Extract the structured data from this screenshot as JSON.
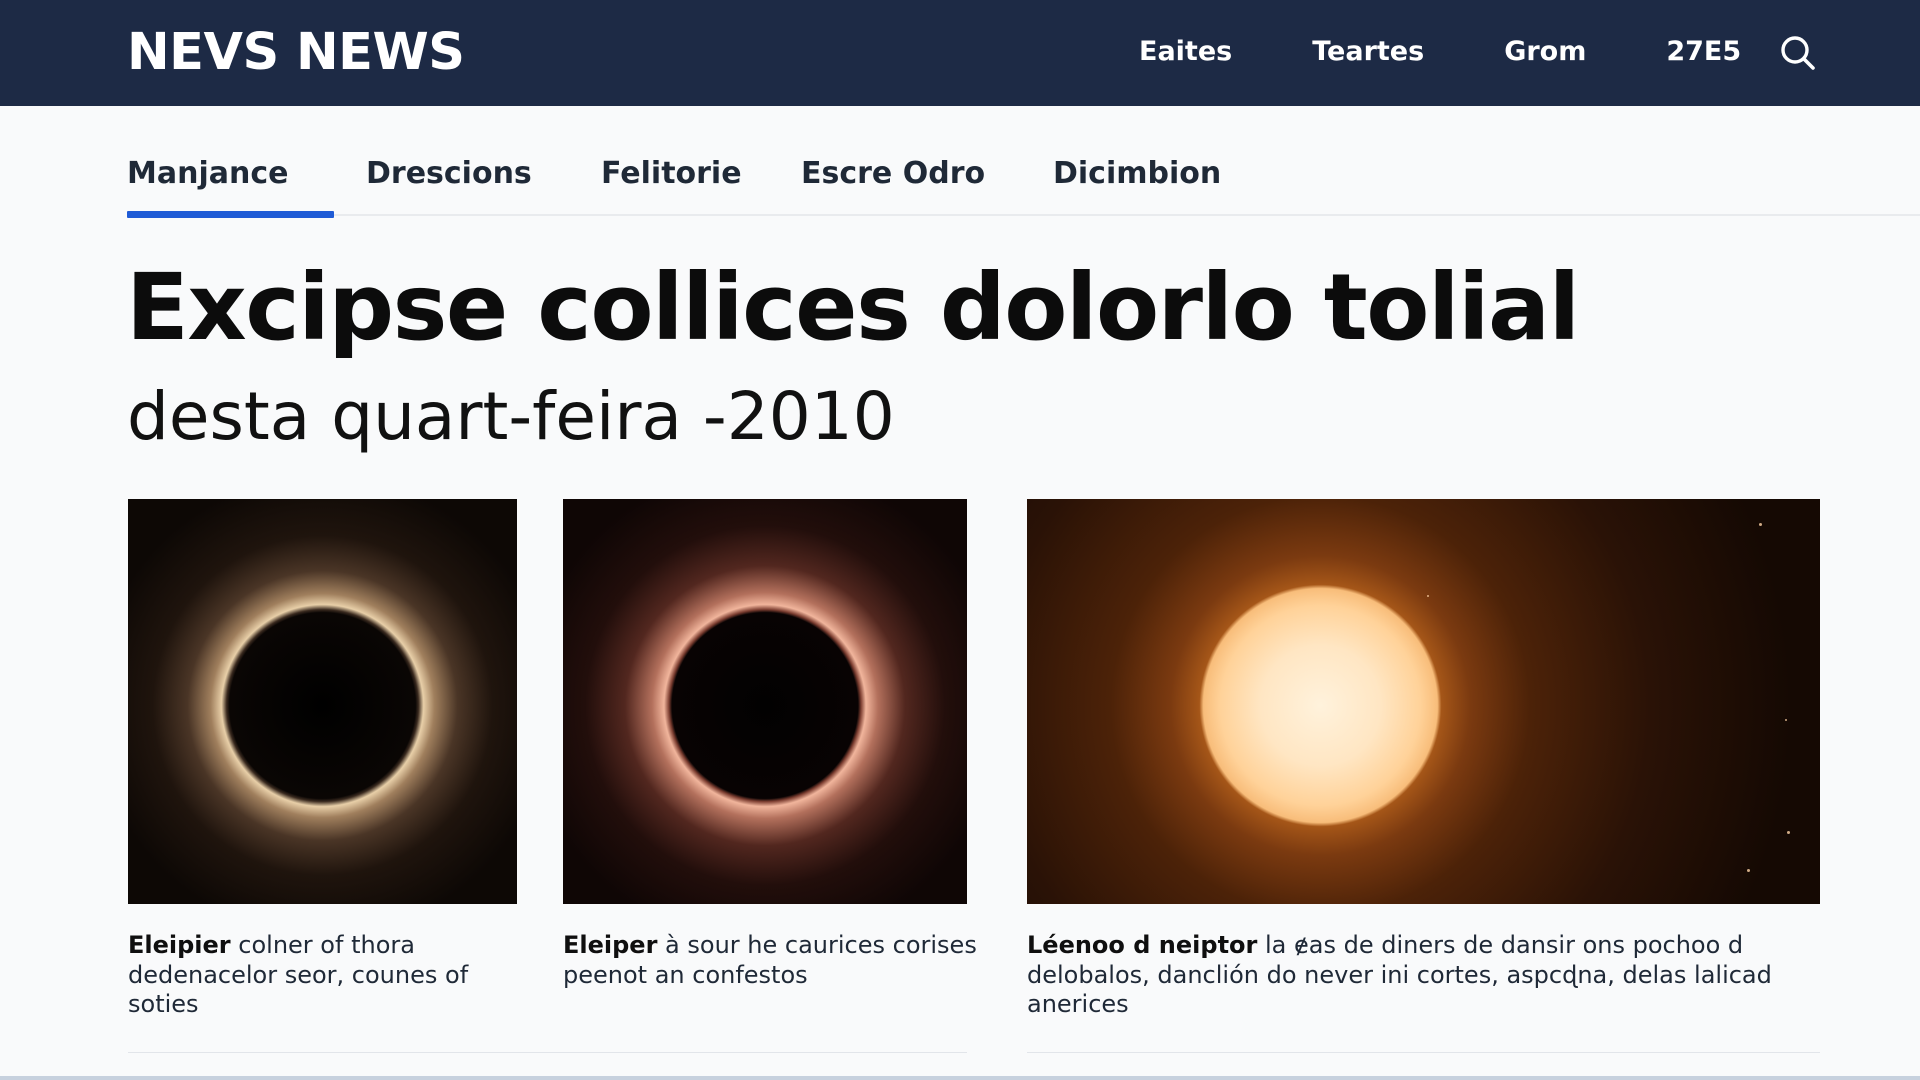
{
  "header": {
    "logo": "NEVS NEWS",
    "nav": [
      "Eaites",
      "Teartes",
      "Grom",
      "27E5"
    ],
    "search_icon": "search-icon"
  },
  "tabs": [
    {
      "label": "Manjance",
      "active": true
    },
    {
      "label": "Drescions",
      "active": false
    },
    {
      "label": "Felitorie",
      "active": false
    },
    {
      "label": "Escre Odro",
      "active": false
    },
    {
      "label": "Dicimbion",
      "active": false
    }
  ],
  "article": {
    "headline": "Excipse collices dolorlo tolial",
    "subheadline": "desta quart-feira -2010"
  },
  "images": [
    {
      "subject": "total-eclipse-corona-warm"
    },
    {
      "subject": "total-eclipse-corona-pink"
    },
    {
      "subject": "glowing-sun"
    }
  ],
  "captions": [
    {
      "bold": "Eleipier",
      "text": " colner of thora dedenacelor seor, counes of soties"
    },
    {
      "bold": "Eleiper",
      "text": " à sour he caurices corises peenot an confestos"
    },
    {
      "bold": "Léenoo  d neiptor",
      "text": " la ɇas de diners de dansir ons pochoo d delobalos, danclión do never ini cortes, aspcɖna, delas lalicad anerices"
    }
  ],
  "colors": {
    "header_bg": "#1d2a45",
    "tab_underline": "#1f5bd6",
    "page_bg": "#f9fafb"
  }
}
